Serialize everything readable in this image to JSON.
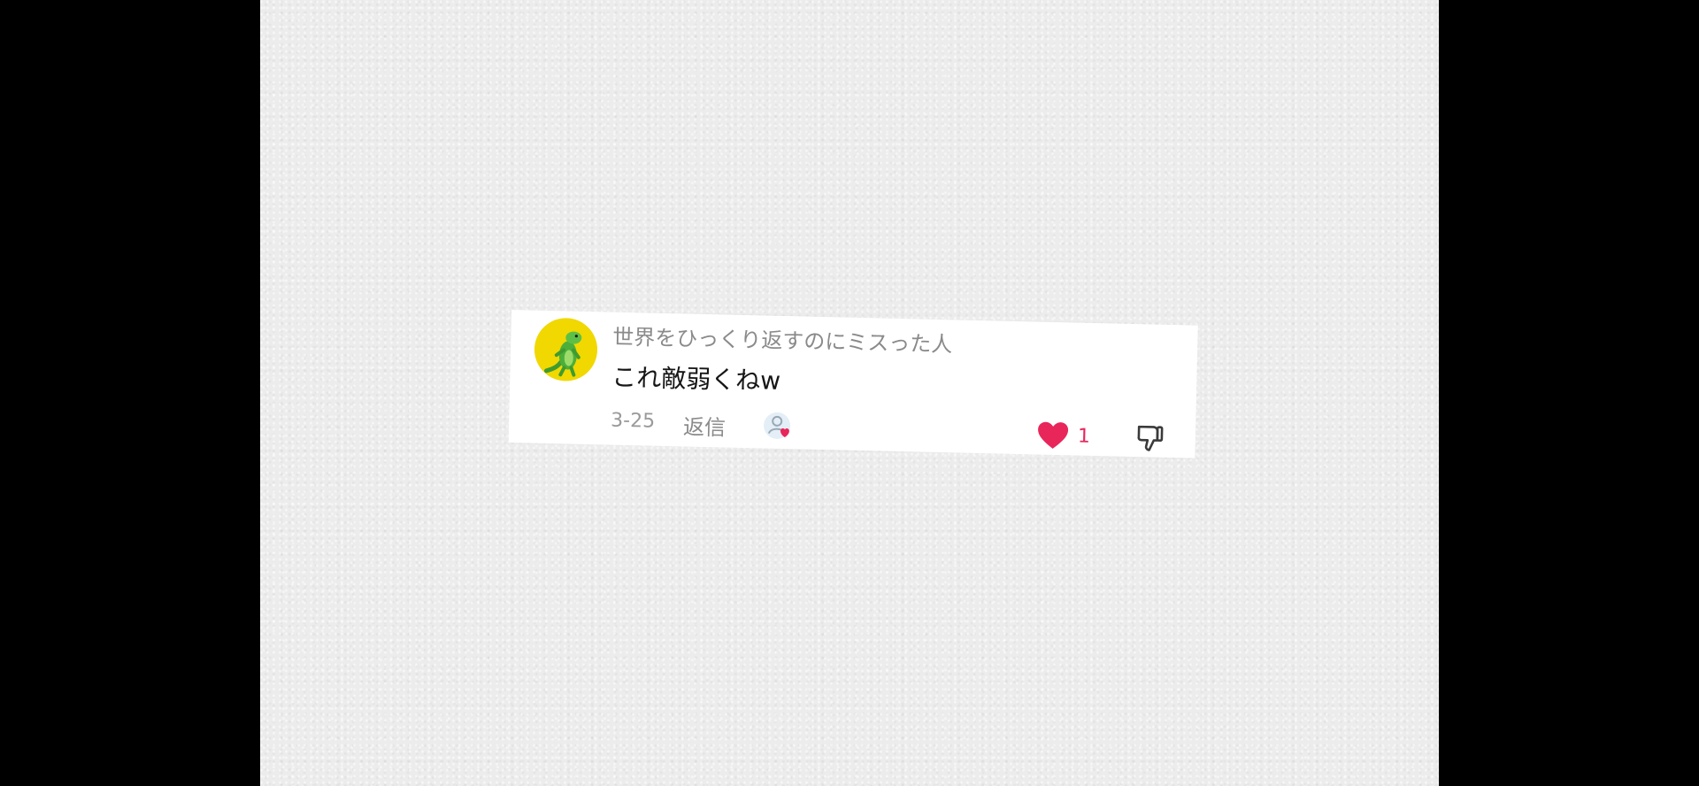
{
  "comment": {
    "username": "世界をひっくり返すのにミスった人",
    "text": "これ敵弱くねw",
    "date": "3-25",
    "reply_label": "返信",
    "like_count": "1",
    "avatar_icon": "green-lizard-avatar",
    "creator_liked_icon": "creator-heart-icon",
    "like_icon": "heart-icon",
    "dislike_icon": "thumbs-down-icon"
  },
  "colors": {
    "like_accent": "#e8265a",
    "avatar_bg": "#f0d800",
    "background": "#ececec",
    "side_bars": "#000000"
  }
}
